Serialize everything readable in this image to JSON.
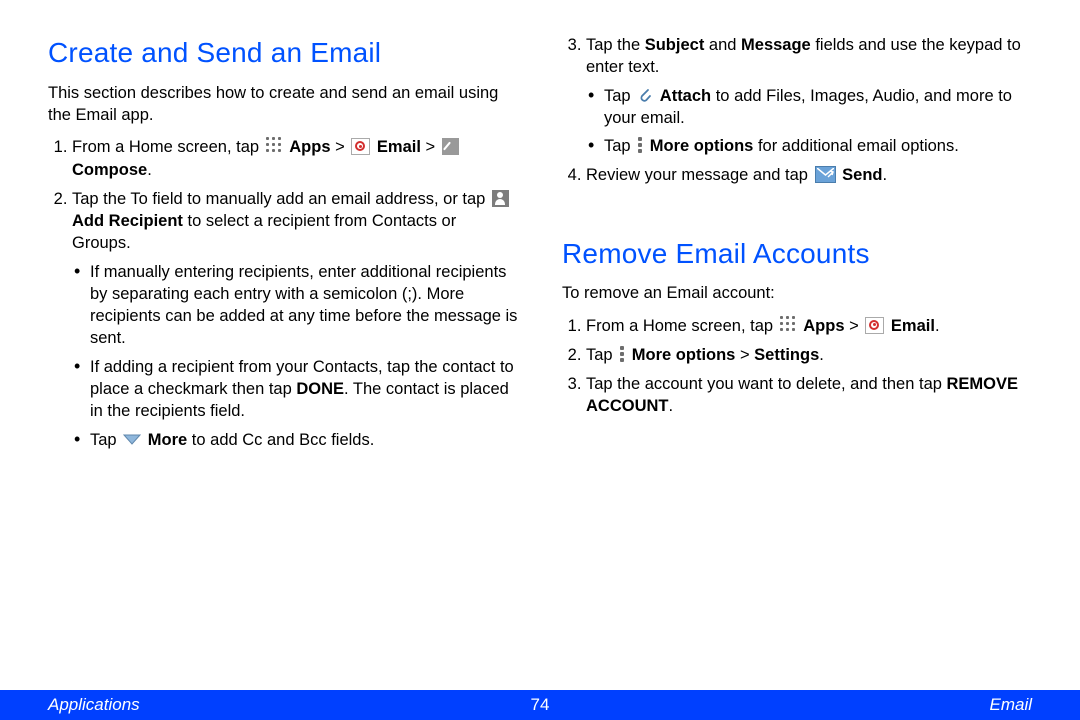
{
  "left": {
    "heading": "Create and Send an Email",
    "intro": "This section describes how to create and send an email using the Email app.",
    "step1": {
      "pre": "From a Home screen, tap ",
      "apps": "Apps",
      "gt1": " > ",
      "email": "Email",
      "gt2": " > ",
      "compose": "Compose",
      "post": "."
    },
    "step2": {
      "pre": "Tap the To field to manually add an email address, or tap ",
      "add_recipient": "Add Recipient",
      "post": " to select a recipient from Contacts or Groups."
    },
    "b1": "If manually entering recipients, enter additional recipients by separating each entry with a semicolon (;). More recipients can be added at any time before the message is sent.",
    "b2": {
      "pre": "If adding a recipient from your Contacts, tap the contact to place a checkmark then tap ",
      "done": "DONE",
      "post": ". The contact is placed in the recipients field."
    },
    "b3": {
      "pre": "Tap ",
      "more": "More",
      "post": " to add Cc and Bcc fields."
    }
  },
  "right_top": {
    "step3": {
      "pre": "Tap the ",
      "subject": "Subject",
      "and": " and ",
      "message": "Message",
      "post": " fields and use the keypad to enter text."
    },
    "b1": {
      "pre": "Tap ",
      "attach": "Attach",
      "post": " to add Files, Images, Audio, and more to your email."
    },
    "b2": {
      "pre": "Tap ",
      "moreopts": "More options",
      "post": " for additional email options."
    },
    "step4": {
      "pre": "Review your message and tap ",
      "send": "Send",
      "post": "."
    }
  },
  "remove": {
    "heading": "Remove Email Accounts",
    "intro": "To remove an Email account:",
    "step1": {
      "pre": "From a Home screen, tap ",
      "apps": "Apps",
      "gt": " > ",
      "email": "Email",
      "post": "."
    },
    "step2": {
      "pre": "Tap ",
      "moreopts": "More options",
      "gt": " > ",
      "settings": "Settings",
      "post": "."
    },
    "step3": {
      "pre": "Tap the account you want to delete, and then tap ",
      "remove_account": "REMOVE ACCOUNT",
      "post": "."
    }
  },
  "footer": {
    "left": "Applications",
    "center": "74",
    "right": "Email"
  }
}
